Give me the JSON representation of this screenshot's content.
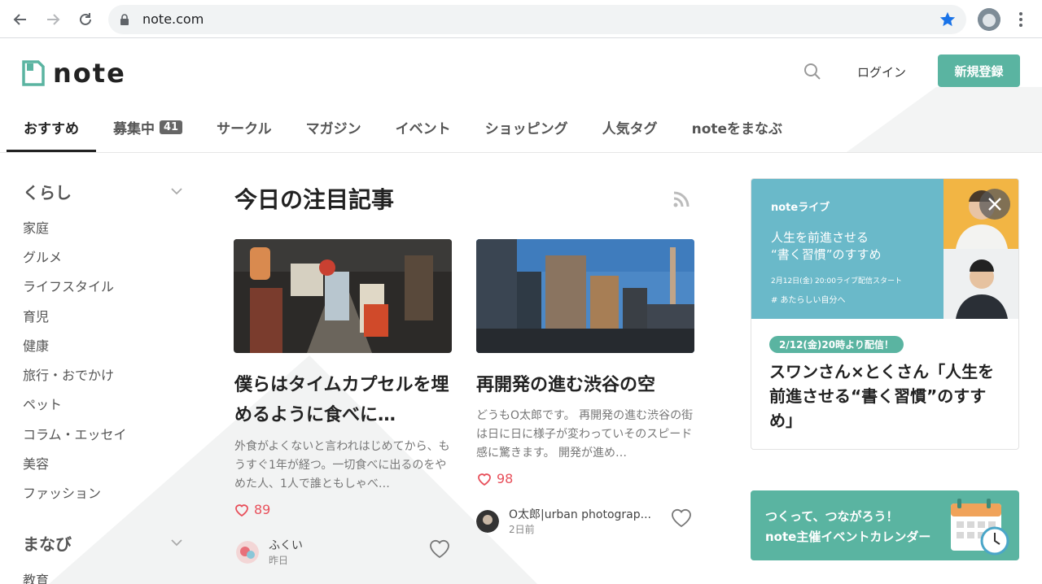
{
  "browser": {
    "url": "note.com",
    "back_icon": "arrow-left",
    "forward_icon": "arrow-right",
    "reload_icon": "reload",
    "lock_icon": "lock",
    "bookmark_icon": "star",
    "accent": "#1a73e8"
  },
  "header": {
    "logo_text": "note",
    "login_label": "ログイン",
    "signup_label": "新規登録",
    "brand_color": "#5ab4a1"
  },
  "tabs": [
    {
      "label": "おすすめ",
      "active": true
    },
    {
      "label": "募集中",
      "badge": "41"
    },
    {
      "label": "サークル"
    },
    {
      "label": "マガジン"
    },
    {
      "label": "イベント"
    },
    {
      "label": "ショッピング"
    },
    {
      "label": "人気タグ"
    },
    {
      "label": "noteをまなぶ"
    }
  ],
  "sidebar": {
    "category1": "くらし",
    "items1": [
      "家庭",
      "グルメ",
      "ライフスタイル",
      "育児",
      "健康",
      "旅行・おでかけ",
      "ペット",
      "コラム・エッセイ",
      "美容",
      "ファッション"
    ],
    "category2": "まなび",
    "items2": [
      "教育"
    ]
  },
  "main": {
    "section_title": "今日の注目記事",
    "cards": [
      {
        "title": "僕らはタイムカプセルを埋めるように食べに…",
        "excerpt": "外食がよくないと言われはじめてから、もうすぐ1年が経つ。一切食べに出るのをやめた人、1人で誰ともしゃべ…",
        "likes": "89",
        "author": "ふくい",
        "date": "昨日"
      },
      {
        "title": "再開発の進む渋谷の空",
        "excerpt": "どうもO太郎です。 再開発の進む渋谷の街は日に日に様子が変わっていそのスピード感に驚きます。 開発が進め…",
        "likes": "98",
        "author": "O太郎|urban photograp...",
        "date": "2日前"
      }
    ]
  },
  "promo": {
    "banner_logo": "noteライブ",
    "banner_line1": "人生を前進させる",
    "banner_line2": "“書く習慣”のすすめ",
    "banner_date": "2月12日(金) 20:00ライブ配信スタート",
    "banner_tag": "# あたらしい自分へ",
    "pill": "2/12(金)20時より配信！",
    "title": "スワンさん×とくさん「人生を前進させる“書く習慣”のすすめ」"
  },
  "event_calendar": {
    "line1": "つくって、つながろう！",
    "line2": "note主催イベントカレンダー"
  }
}
